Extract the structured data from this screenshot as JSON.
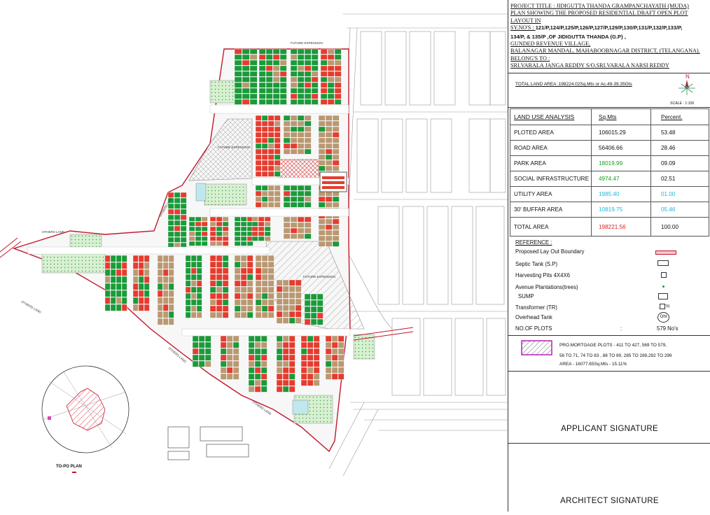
{
  "title_block": {
    "line1": "PROJECT TITLE : JIDIGUTTA THANDA GRAMPANCHAYATH (MUDA)",
    "line2": "PLAN SHOWING THE PROPOSED RESIDENTIAL  DRAFT OPEN PLOT",
    "line3": "LAYOUT  IN",
    "line4a": "SY.NO'S : ",
    "line4b": "121/P,124/P,125/P,126/P,127/P,129/P,130/P,131/P,132/P,133/P,",
    "line5a": "134/P, & 135/P ,OF ",
    "line5b": "JIDIGUTTA THANDA (G.P) ,",
    "line6": "GUNDED REVENUE VILLAGE,",
    "line7": "BALANAGAR  MANDAL, MAHABOOBNAGAR  DISTRICT, (TELANGANA).",
    "line8": "BELONG'S TO :",
    "line9": "SRI.VARALA JANGA REDDY  S/O.SRI.VARALA NARSI REDDY"
  },
  "total_land": "TOTAL  LAND AREA     :198224.02Sq.Mts  or Ac.49-39.35Gts",
  "scale": "SCALE   : 1:100",
  "north_label": "N",
  "land_use": {
    "headers": [
      "LAND USE ANALYSIS",
      "Sq.Mts",
      "Percent."
    ],
    "rows": [
      {
        "label": "PLOTED AREA",
        "sqm": "106015.29",
        "percent": "53.48",
        "color": "#111111"
      },
      {
        "label": "ROAD AREA",
        "sqm": "56406.66",
        "percent": "28.46",
        "color": "#111111"
      },
      {
        "label": "PARK AREA",
        "sqm": "18019.99",
        "percent": "09.09",
        "color": "#16a016"
      },
      {
        "label": "SOCIAL INFRASTRUCTURE",
        "sqm": "4974.47",
        "percent": "02.51",
        "color": "#16a016"
      },
      {
        "label": "UTILITY AREA",
        "sqm": "1985.40",
        "percent": "01.00",
        "color": "#1fb7d6"
      },
      {
        "label": "30' BUFFAR AREA",
        "sqm": "10819.75",
        "percent": "05.46",
        "color": "#1fb7d6"
      }
    ],
    "total": {
      "label": "TOTAL AREA",
      "sqm": "198221.56",
      "percent": "100.00",
      "color": "#d21f1f"
    }
  },
  "reference": {
    "heading": "REFERENCE :",
    "boundary": "Proposed Lay Out Boundary",
    "septic": "Septic Tank  (S.P)",
    "harvesting": "Harvesting  Pits   4X4X6",
    "avenue": "Avenue Plantations(trees)",
    "sump": "SUMP",
    "transformer": "Transformer  (TR)",
    "transformer_sym": "TR",
    "overhead": "Overhead Tank",
    "overhead_sym": "Oht",
    "plots_label": "NO.OF PLOTS",
    "plots_colon": ":",
    "plots_value": "579  No's"
  },
  "mortgage": {
    "line1": "PRO.MORTGAGE PLOTS - 411 TO 427, 569 TO 579,",
    "line2": "56 TO 71, 74 TO 83 , 88 TO 89, 285 TO 289,292 TO 299",
    "line3": "AREA  - 16077.65Sq.Mts - 15.11%"
  },
  "signatures": {
    "applicant": "APPLICANT  SIGNATURE",
    "architect": "ARCHITECT  SIGNATURE"
  },
  "map_labels": {
    "future_expension_top": "FUTURE EXPENSION",
    "future_expension_left": "FUTURE EXPENSION",
    "future_expension_mid": "FUTURE EXPENSION",
    "future_expension_center": "FUTURE EXPENSION",
    "others_land_1": "OTHERS LAND",
    "others_land_2": "OTHERS LAND",
    "others_land_3": "OTHERS LAND",
    "others_land_4": "OTHERS LAND",
    "others_land_5": "OTHERS LAND",
    "topo_plan": "TO-PO PLAN"
  },
  "colors": {
    "plot_red": "#e53c2e",
    "plot_green": "#1b9a3a",
    "plot_brown": "#b99872",
    "park_dots": "#c9e8c4",
    "utility": "#bfe7ee",
    "boundary": "#c0182b",
    "mortgage_hatch": "#c0182b"
  }
}
